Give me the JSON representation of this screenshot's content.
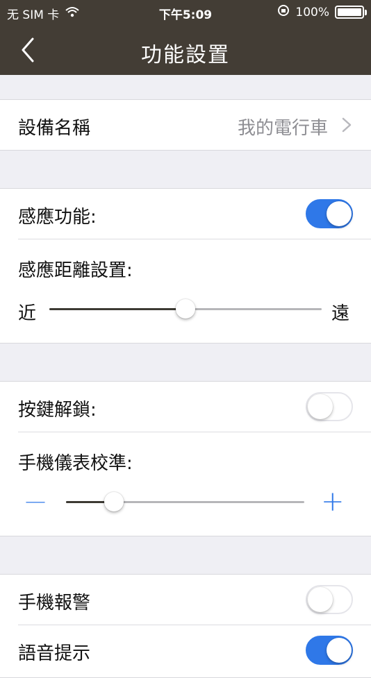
{
  "status_bar": {
    "carrier": "无 SIM 卡",
    "time": "下午5:09",
    "battery": "100%",
    "icons": [
      "wifi-icon",
      "orientation-lock-icon",
      "battery-icon"
    ]
  },
  "nav": {
    "title": "功能設置",
    "back_icon": "chevron-left-icon"
  },
  "device": {
    "label": "設備名稱",
    "value": "我的電行車"
  },
  "sensing": {
    "toggle_label": "感應功能:",
    "toggle_on": true,
    "distance_label": "感應距離設置:",
    "min_label": "近",
    "max_label": "遠",
    "distance_value_fraction": 0.5
  },
  "unlock": {
    "toggle_label": "按鍵解鎖:",
    "toggle_on": false,
    "calibration_label": "手機儀表校準:",
    "minus_label": "—",
    "plus_label": "+",
    "calibration_value_fraction": 0.2
  },
  "alerts": {
    "alarm_label": "手機報警",
    "alarm_on": false,
    "voice_label": "語音提示",
    "voice_on": true
  },
  "colors": {
    "header": "#433d35",
    "accent": "#2f78e8",
    "background": "#efeff4"
  }
}
